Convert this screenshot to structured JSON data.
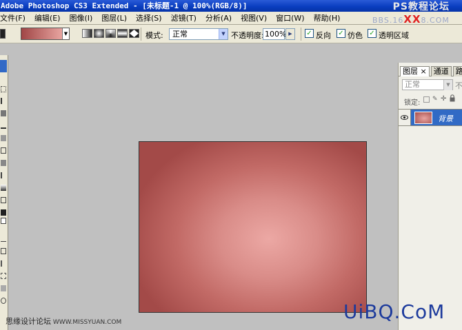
{
  "window": {
    "title": "Adobe Photoshop CS3 Extended - [未标题-1 @ 100%(RGB/8)]"
  },
  "menu": [
    {
      "label": "文件(F)"
    },
    {
      "label": "编辑(E)"
    },
    {
      "label": "图像(I)"
    },
    {
      "label": "图层(L)"
    },
    {
      "label": "选择(S)"
    },
    {
      "label": "滤镜(T)"
    },
    {
      "label": "分析(A)"
    },
    {
      "label": "视图(V)"
    },
    {
      "label": "窗口(W)"
    },
    {
      "label": "帮助(H)"
    }
  ],
  "options": {
    "mode_label": "模式:",
    "mode_value": "正常",
    "opacity_label": "不透明度:",
    "opacity_value": "100%",
    "reverse_label": "反向",
    "reverse_checked": true,
    "dither_label": "仿色",
    "dither_checked": true,
    "transparency_label": "透明区域",
    "transparency_checked": true,
    "gradient_colors": [
      "#a04646",
      "#e8a4a0"
    ],
    "gradient_types": [
      "linear-gradient-icon",
      "radial-gradient-icon",
      "angle-gradient-icon",
      "reflected-gradient-icon",
      "diamond-gradient-icon"
    ]
  },
  "canvas": {
    "colors": [
      "#eca8a4",
      "#a34a48"
    ]
  },
  "layers_panel": {
    "tabs": [
      {
        "label": "图层",
        "active": true,
        "close": "×"
      },
      {
        "label": "通道",
        "active": false
      },
      {
        "label": "路",
        "active": false
      }
    ],
    "blend_mode": "正常",
    "opacity_label": "不",
    "lock_label": "锁定:",
    "layers": [
      {
        "name": "背景",
        "visible": true,
        "selected": true
      }
    ]
  },
  "watermarks": {
    "top_right": "PS教程论坛",
    "top_right_sub": "BBS.16",
    "top_right_red": "XX",
    "top_right_sub_end": "8.COM",
    "bottom_left_big": "思缘设计论坛",
    "bottom_left_small": "WWW.MISSYUAN.COM",
    "bottom_right": "UiBQ.CoM"
  }
}
